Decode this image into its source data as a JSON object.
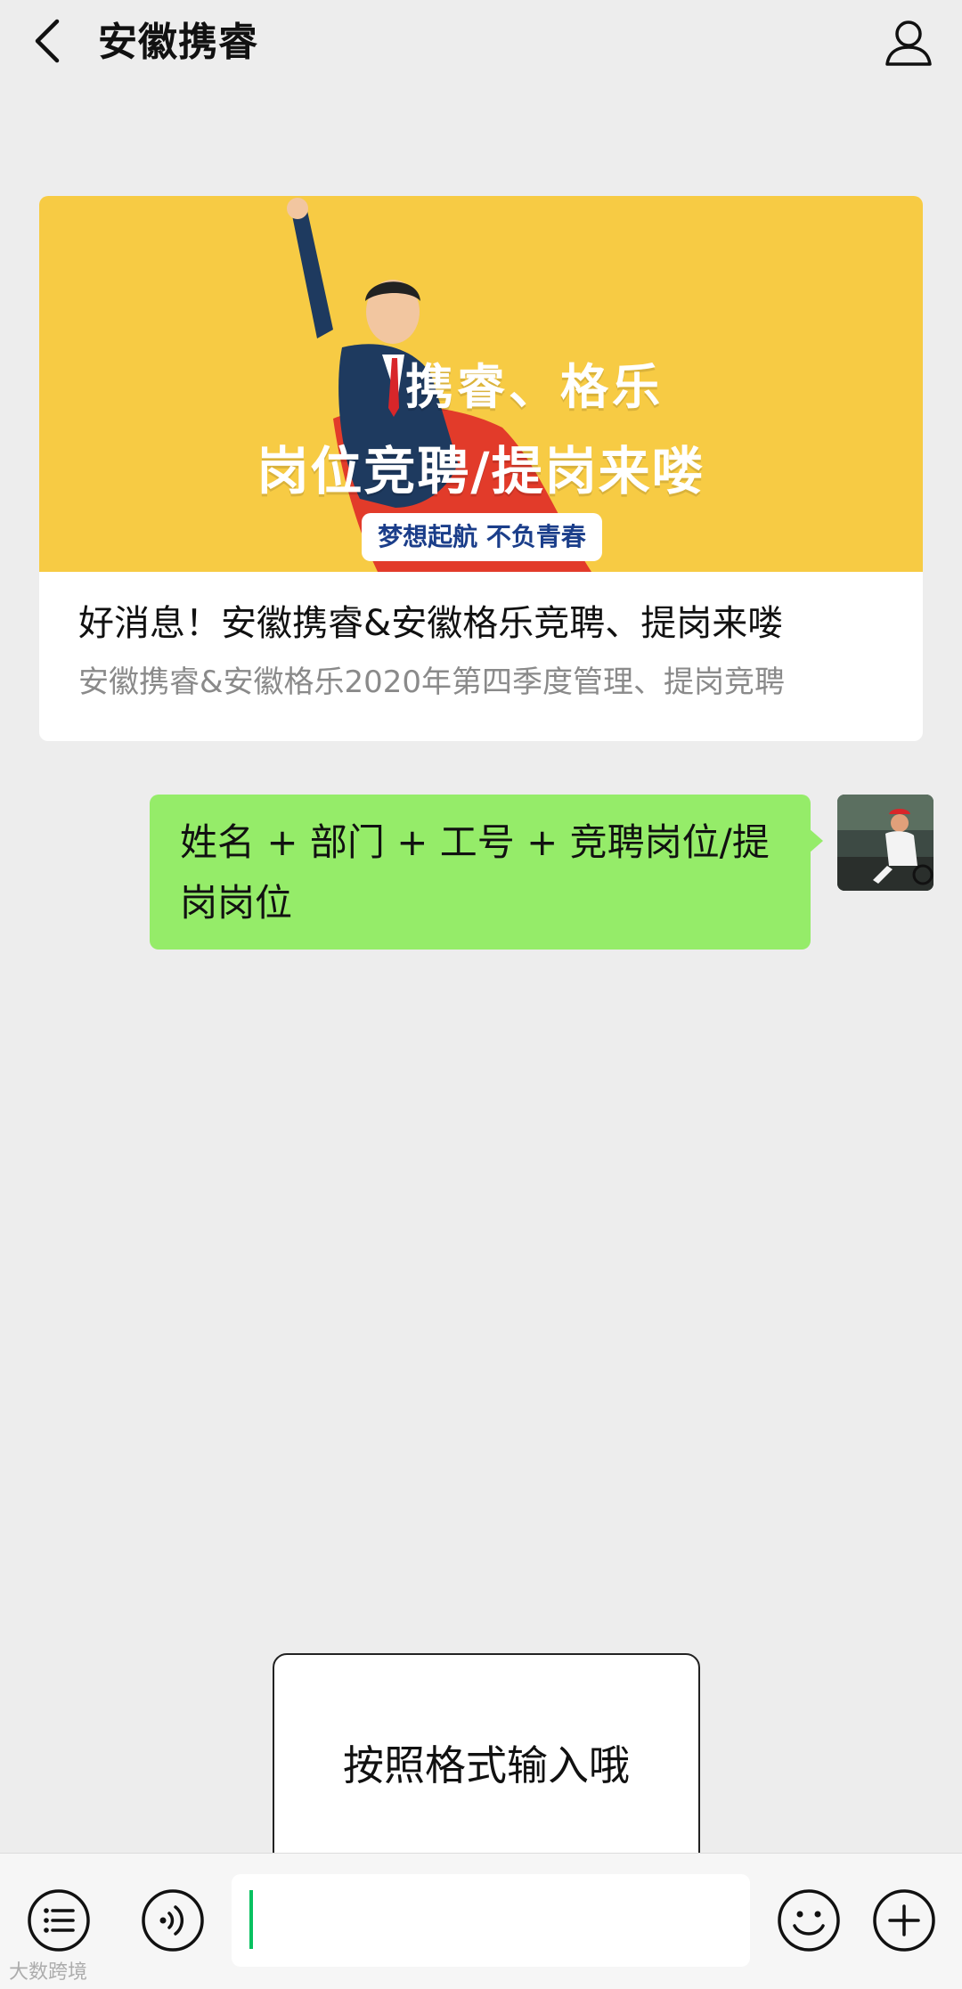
{
  "header": {
    "title": "安徽携睿",
    "back_icon": "chevron-left-icon",
    "profile_icon": "person-icon"
  },
  "article": {
    "banner": {
      "line1": "携睿、格乐",
      "line2": "岗位竞聘/提岗来喽",
      "badge": "梦想起航 不负青春",
      "background_color": "#f7cb44"
    },
    "title": "好消息！安徽携睿&安徽格乐竞聘、提岗来喽",
    "description": "安徽携睿&安徽格乐2020年第四季度管理、提岗竞聘"
  },
  "message": {
    "text": "姓名 + 部门 + 工号 + 竞聘岗位/提岗岗位",
    "bubble_color": "#95ec69"
  },
  "tooltip": {
    "text": "按照格式输入哦"
  },
  "input_bar": {
    "menu_icon": "list-menu-icon",
    "voice_icon": "voice-icon",
    "emoji_icon": "emoji-icon",
    "plus_icon": "plus-icon",
    "cursor_color": "#07c160"
  },
  "watermark": "大数跨境"
}
